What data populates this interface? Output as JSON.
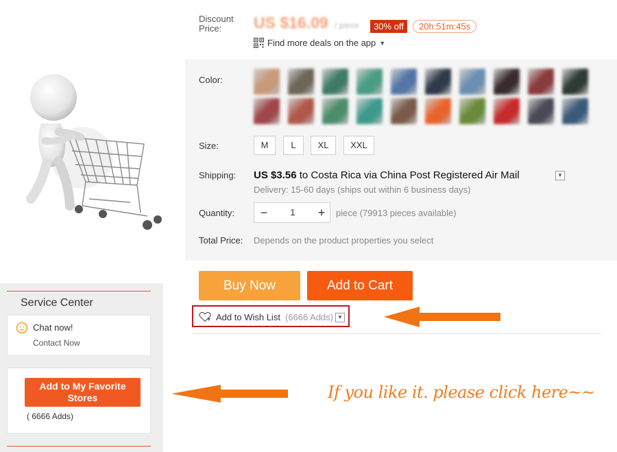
{
  "price": {
    "label": "Discount Price:",
    "value": "US $16.09",
    "unit": "/ piece",
    "discount_badge": "30% off",
    "timer": "20h:51m:45s",
    "deals_link": "Find more deals on the app"
  },
  "options": {
    "color_label": "Color:",
    "swatch_colors": [
      "#c79a7a",
      "#6c6558",
      "#3f7a66",
      "#4a9c85",
      "#5575a8",
      "#2f3a4a",
      "#6a8fb0",
      "#3a2c2e",
      "#8a3b3b",
      "#2e3a33",
      "#a0464a",
      "#b0584a",
      "#4c8d6c",
      "#3d9a8d",
      "#7a5a4a",
      "#e8642c",
      "#6a8a3a",
      "#c72a2a",
      "#4a4a58",
      "#3a5a7a"
    ],
    "size_label": "Size:",
    "sizes": [
      "M",
      "L",
      "XL",
      "XXL"
    ],
    "shipping_label": "Shipping:",
    "shipping_cost": "US $3.56",
    "shipping_rest": " to Costa Rica via China Post Registered Air Mail",
    "delivery": "Delivery: 15-60 days (ships out within 6 business days)",
    "quantity_label": "Quantity:",
    "quantity_value": "1",
    "quantity_minus": "−",
    "quantity_plus": "+",
    "quantity_note": "piece (79913 pieces available)",
    "total_label": "Total Price:",
    "total_note": "Depends on the product properties you select"
  },
  "actions": {
    "buy_now": "Buy Now",
    "add_to_cart": "Add to Cart",
    "wish_label": "Add to Wish List",
    "wish_count": "(6666 Adds)"
  },
  "service": {
    "title": "Service Center",
    "chat_now": "Chat now!",
    "contact_now": "Contact Now",
    "favorite_button": "Add to My Favorite Stores",
    "favorite_count": "( 6666 Adds)"
  },
  "annotation": {
    "text": "If you like it. please click here~~",
    "color": "#f27c1e"
  }
}
